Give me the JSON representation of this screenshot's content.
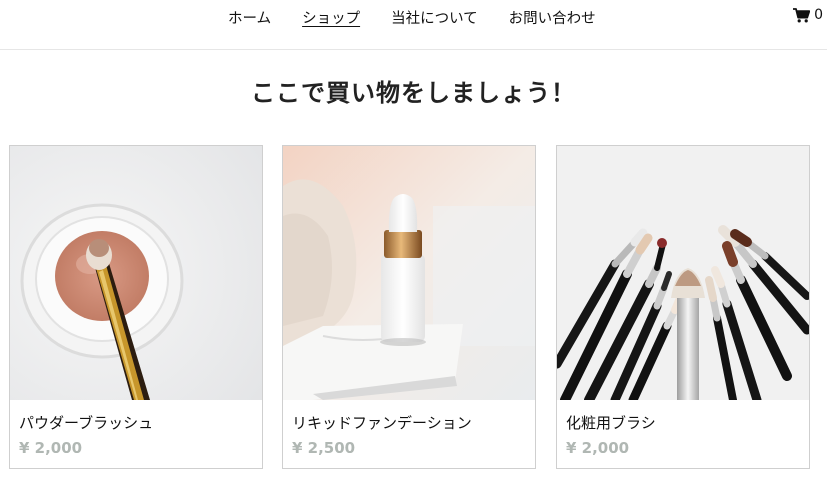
{
  "nav": {
    "items": [
      {
        "label": "ホーム",
        "active": false
      },
      {
        "label": "ショップ",
        "active": true
      },
      {
        "label": "当社について",
        "active": false
      },
      {
        "label": "お問い合わせ",
        "active": false
      }
    ]
  },
  "cart": {
    "icon": "shopping-cart-icon",
    "count": "0"
  },
  "page": {
    "heading": "ここで買い物をしましょう！"
  },
  "products": [
    {
      "name": "パウダーブラッシュ",
      "price": "¥ 2,000",
      "image": "powder-blush-photo"
    },
    {
      "name": "リキッドファンデーション",
      "price": "¥ 2,500",
      "image": "liquid-foundation-photo"
    },
    {
      "name": "化粧用ブラシ",
      "price": "¥ 2,000",
      "image": "makeup-brushes-photo"
    }
  ],
  "colors": {
    "price": "#b0b7b3",
    "border": "#cfcfcf"
  }
}
